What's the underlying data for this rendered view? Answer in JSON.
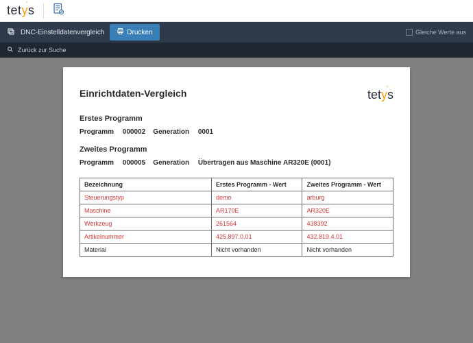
{
  "brand": "tetys",
  "toolbar": {
    "title": "DNC-Einstelldatenvergleich",
    "print_label": "Drucken",
    "filter_label": "Gleiche Werte aus"
  },
  "searchbar": {
    "back_label": "Zurück zur Suche"
  },
  "report": {
    "title": "Einrichtdaten-Vergleich",
    "program1": {
      "heading": "Erstes Programm",
      "label_program": "Programm",
      "program": "000002",
      "label_generation": "Generation",
      "generation": "0001"
    },
    "program2": {
      "heading": "Zweites Programm",
      "label_program": "Programm",
      "program": "000005",
      "label_generation": "Generation",
      "generation": "Übertragen aus Maschine AR320E (0001)"
    },
    "table": {
      "headers": {
        "col1": "Bezeichnung",
        "col2": "Erstes Programm - Wert",
        "col3": "Zweites Programm - Wert"
      },
      "rows": [
        {
          "label": "Steuerungstyp",
          "v1": "demo",
          "v2": "arburg",
          "diff": true
        },
        {
          "label": "Maschine",
          "v1": "AR170E",
          "v2": "AR320E",
          "diff": true
        },
        {
          "label": "Werkzeug",
          "v1": "261564",
          "v2": "438392",
          "diff": true
        },
        {
          "label": "Artikelnummer",
          "v1": "425.897.0.01",
          "v2": "432.819.4.01",
          "diff": true
        },
        {
          "label": "Material",
          "v1": "Nicht vorhanden",
          "v2": "Nicht vorhanden",
          "diff": false
        }
      ]
    }
  }
}
